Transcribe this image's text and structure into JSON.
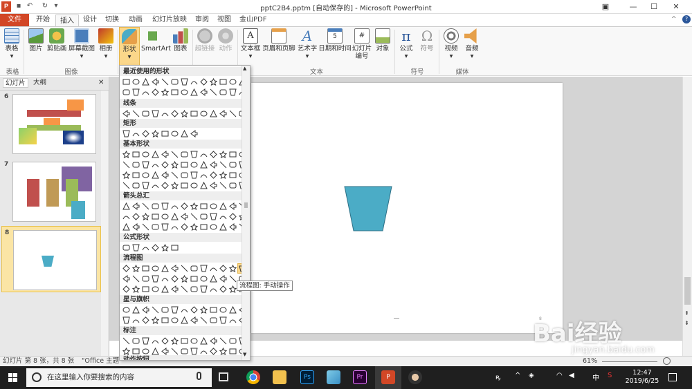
{
  "window": {
    "title": "pptC2B4.pptm [自动保存的] - Microsoft PowerPoint",
    "help": "?"
  },
  "tabs": [
    "文件",
    "开始",
    "插入",
    "设计",
    "切换",
    "动画",
    "幻灯片放映",
    "审阅",
    "视图",
    "金山PDF"
  ],
  "active_tab": "插入",
  "ribbon": {
    "buttons": [
      {
        "label": "表格",
        "icon": "table-icon"
      },
      {
        "label": "图片",
        "icon": "picture-icon"
      },
      {
        "label": "剪贴画",
        "icon": "clipart-icon"
      },
      {
        "label": "屏幕截图",
        "icon": "screenshot-icon"
      },
      {
        "label": "相册",
        "icon": "album-icon"
      },
      {
        "label": "形状",
        "icon": "shapes-icon"
      },
      {
        "label": "SmartArt",
        "icon": "smartart-icon"
      },
      {
        "label": "图表",
        "icon": "chart-icon"
      },
      {
        "label": "超链接",
        "icon": "hyperlink-icon"
      },
      {
        "label": "动作",
        "icon": "action-icon"
      },
      {
        "label": "文本框",
        "icon": "textbox-icon"
      },
      {
        "label": "页眉和页脚",
        "icon": "header-footer-icon"
      },
      {
        "label": "艺术字",
        "icon": "wordart-icon"
      },
      {
        "label": "日期和时间",
        "icon": "datetime-icon"
      },
      {
        "label": "幻灯片编号",
        "icon": "slide-number-icon"
      },
      {
        "label": "对象",
        "icon": "object-icon"
      },
      {
        "label": "公式",
        "icon": "equation-icon"
      },
      {
        "label": "符号",
        "icon": "symbol-icon"
      },
      {
        "label": "视频",
        "icon": "video-icon"
      },
      {
        "label": "音频",
        "icon": "audio-icon"
      }
    ],
    "groups": [
      "表格",
      "图像",
      "文本",
      "符号",
      "媒体"
    ]
  },
  "left_pane": {
    "tabs": [
      "幻灯片",
      "大纲"
    ],
    "close": "✕",
    "slides": [
      "6",
      "7",
      "8"
    ],
    "selected": "8"
  },
  "shapes_menu": {
    "categories": [
      "最近使用的形状",
      "线条",
      "矩形",
      "基本形状",
      "箭头总汇",
      "公式形状",
      "流程图",
      "星与旗帜",
      "标注",
      "动作按钮"
    ],
    "tooltip": "流程图: 手动操作"
  },
  "status": {
    "slide_info": "幻灯片 第 8 张，共 8 张",
    "theme": "\"Office 主题",
    "zoom": "61%"
  },
  "taskbar": {
    "search_placeholder": "在这里输入你要搜索的内容",
    "time": "12:47",
    "date": "2019/6/25",
    "ime": "中",
    "apps": [
      "task-view-icon",
      "chrome-icon",
      "folder-icon",
      "photoshop-icon",
      "app-icon",
      "premiere-icon",
      "powerpoint-icon",
      "avatar-icon"
    ]
  },
  "watermark": {
    "brand": "Bai经验",
    "url": "jingyan.baidu.com"
  },
  "colors": {
    "file_tab": "#d24726",
    "shape_fill": "#4bacc6",
    "selection": "#fbe5a5",
    "taskbar": "#1f1f1f"
  }
}
